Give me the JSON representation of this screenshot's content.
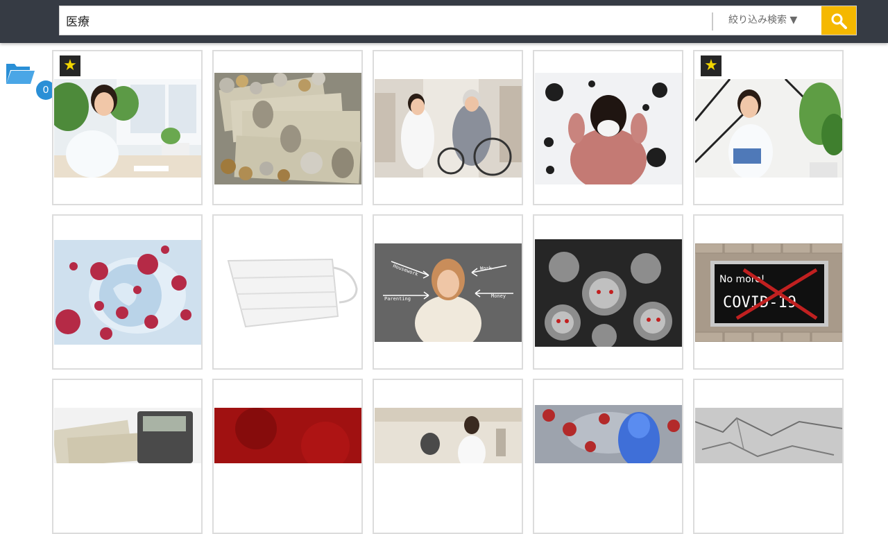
{
  "search": {
    "value": "医療",
    "filter_label": "絞り込み検索 ▼"
  },
  "folder": {
    "count": "0"
  },
  "gallery": {
    "items": [
      {
        "subject": "smiling nurse writing at desk",
        "favorite": true
      },
      {
        "subject": "Japanese yen banknotes and coins",
        "favorite": false
      },
      {
        "subject": "caregiver with elderly woman in wheelchair",
        "favorite": false
      },
      {
        "subject": "woman in mask surrounded by virus germs",
        "favorite": false
      },
      {
        "subject": "smiling nurse with clipboard",
        "favorite": true
      },
      {
        "subject": "red viruses around globe",
        "favorite": false
      },
      {
        "subject": "white surgical mask",
        "favorite": false
      },
      {
        "subject": "stressed woman with arrows",
        "favorite": false
      },
      {
        "subject": "angry coronavirus particles",
        "favorite": false
      },
      {
        "subject": "No more COVID-19 sign on brick wall",
        "favorite": false
      },
      {
        "subject": "banknotes and calculator",
        "favorite": false
      },
      {
        "subject": "dark red texture",
        "favorite": false
      },
      {
        "subject": "rehabilitation hallway",
        "favorite": false
      },
      {
        "subject": "virus attacking human figure",
        "favorite": false
      },
      {
        "subject": "cracked gray wall texture",
        "favorite": false
      }
    ]
  },
  "sign": {
    "line1": "No more!",
    "line2": "COVID-19"
  },
  "stress_labels": [
    "Housework",
    "Work",
    "Parenting",
    "Money"
  ],
  "colors": {
    "topbar": "#363b44",
    "search_button": "#f5b800",
    "accent_blue": "#2a8fd6",
    "star": "#f3d600"
  }
}
